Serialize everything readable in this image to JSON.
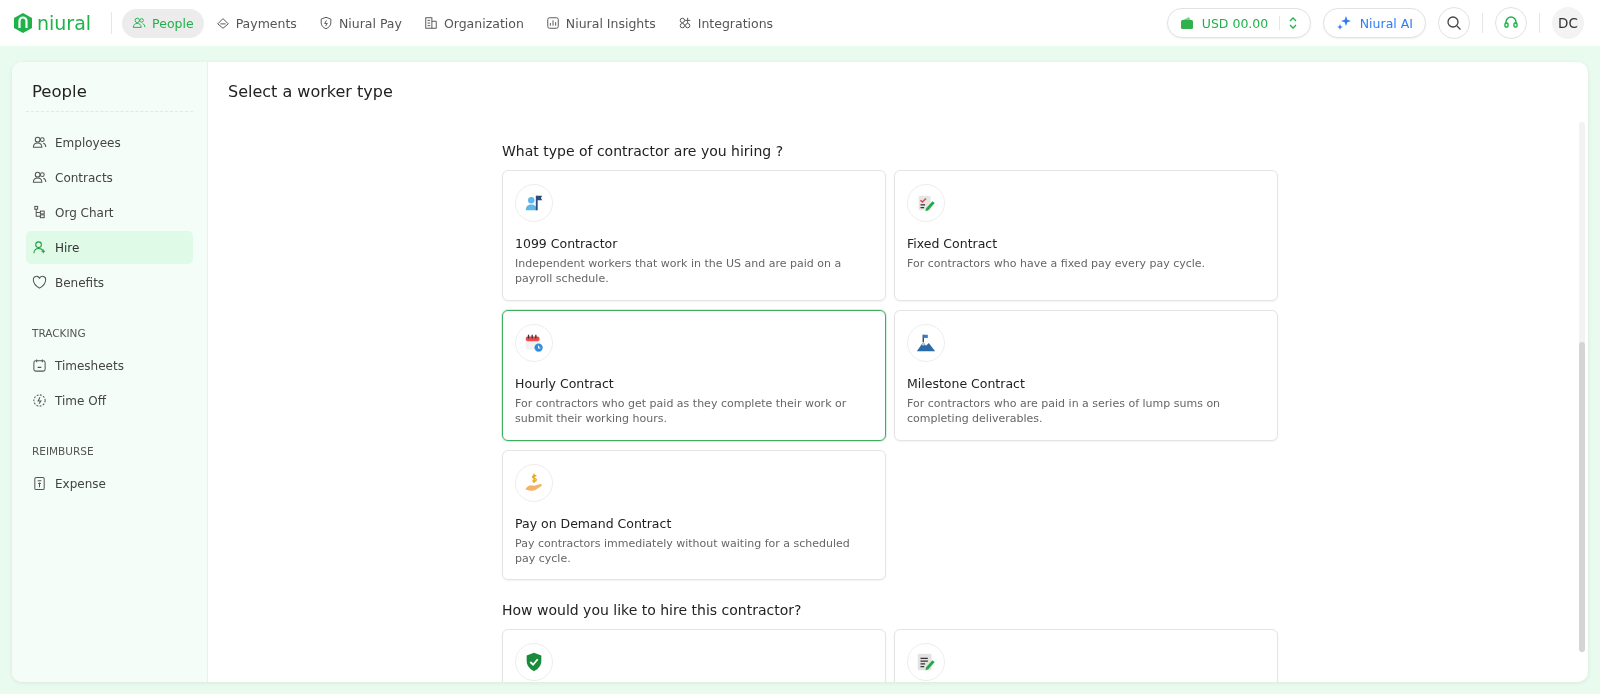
{
  "brand": "niural",
  "nav": [
    {
      "label": "People",
      "selected": true
    },
    {
      "label": "Payments",
      "selected": false
    },
    {
      "label": "Niural Pay",
      "selected": false
    },
    {
      "label": "Organization",
      "selected": false
    },
    {
      "label": "Niural Insights",
      "selected": false
    },
    {
      "label": "Integrations",
      "selected": false
    }
  ],
  "balance": "USD 00.00",
  "ai_button": "Niural AI",
  "avatar": "DC",
  "sidebar": {
    "title": "People",
    "sections": [
      {
        "items": [
          {
            "label": "Employees",
            "selected": false
          },
          {
            "label": "Contracts",
            "selected": false
          },
          {
            "label": "Org Chart",
            "selected": false
          },
          {
            "label": "Hire",
            "selected": true
          },
          {
            "label": "Benefits",
            "selected": false
          }
        ]
      },
      {
        "heading": "TRACKING",
        "items": [
          {
            "label": "Timesheets",
            "selected": false
          },
          {
            "label": "Time Off",
            "selected": false
          }
        ]
      },
      {
        "heading": "REIMBURSE",
        "items": [
          {
            "label": "Expense",
            "selected": false
          }
        ]
      }
    ]
  },
  "page_title": "Select a worker type",
  "contractor_question": "What type of contractor are you hiring ?",
  "contractor_types": [
    {
      "title": "1099 Contractor",
      "description": "Independent workers that work in the US and are paid on a payroll schedule.",
      "selected": false
    },
    {
      "title": "Fixed Contract",
      "description": "For contractors who have a fixed pay every pay cycle.",
      "selected": false
    },
    {
      "title": "Hourly Contract",
      "description": "For contractors who get paid as they complete their work or submit their working hours.",
      "selected": true
    },
    {
      "title": "Milestone Contract",
      "description": "For contractors who are paid in a series of lump sums on completing deliverables.",
      "selected": false
    },
    {
      "title": "Pay on Demand Contract",
      "description": "Pay contractors immediately without waiting for a scheduled pay cycle.",
      "selected": false
    }
  ],
  "hire_question": "How would you like to hire this contractor?",
  "hire_methods": [
    {
      "selected": false
    },
    {
      "selected": false
    }
  ]
}
